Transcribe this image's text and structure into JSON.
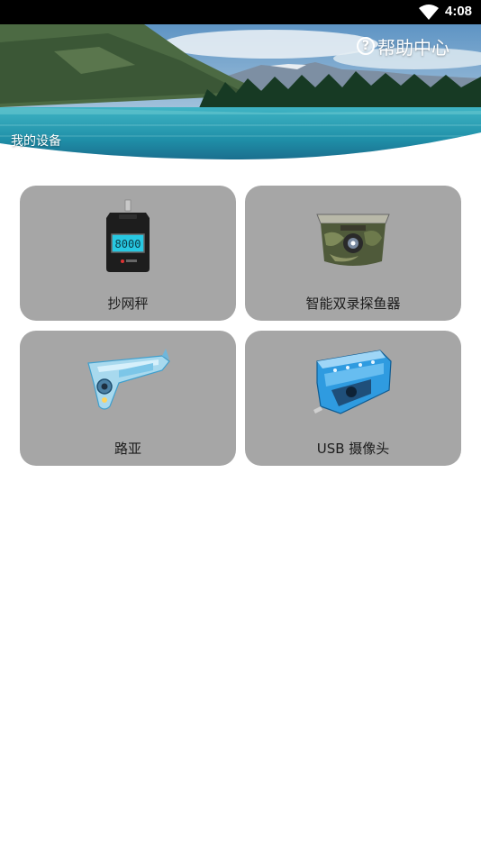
{
  "status_bar": {
    "time": "4:08",
    "icons": [
      "wifi-icon"
    ]
  },
  "header": {
    "help_center": "帮助中心",
    "help_icon": "question-circle-icon",
    "section_title": "我的设备"
  },
  "devices": [
    {
      "label": "抄网秤",
      "icon": "scale-device-icon"
    },
    {
      "label": "智能双录探鱼器",
      "icon": "fish-finder-camera-icon"
    },
    {
      "label": "路亚",
      "icon": "lure-camera-icon"
    },
    {
      "label": "USB 摄像头",
      "icon": "usb-camera-icon"
    }
  ],
  "colors": {
    "card_bg": "#a6a6a6",
    "status_bar": "#000000",
    "lake": "#2aa3b8"
  }
}
